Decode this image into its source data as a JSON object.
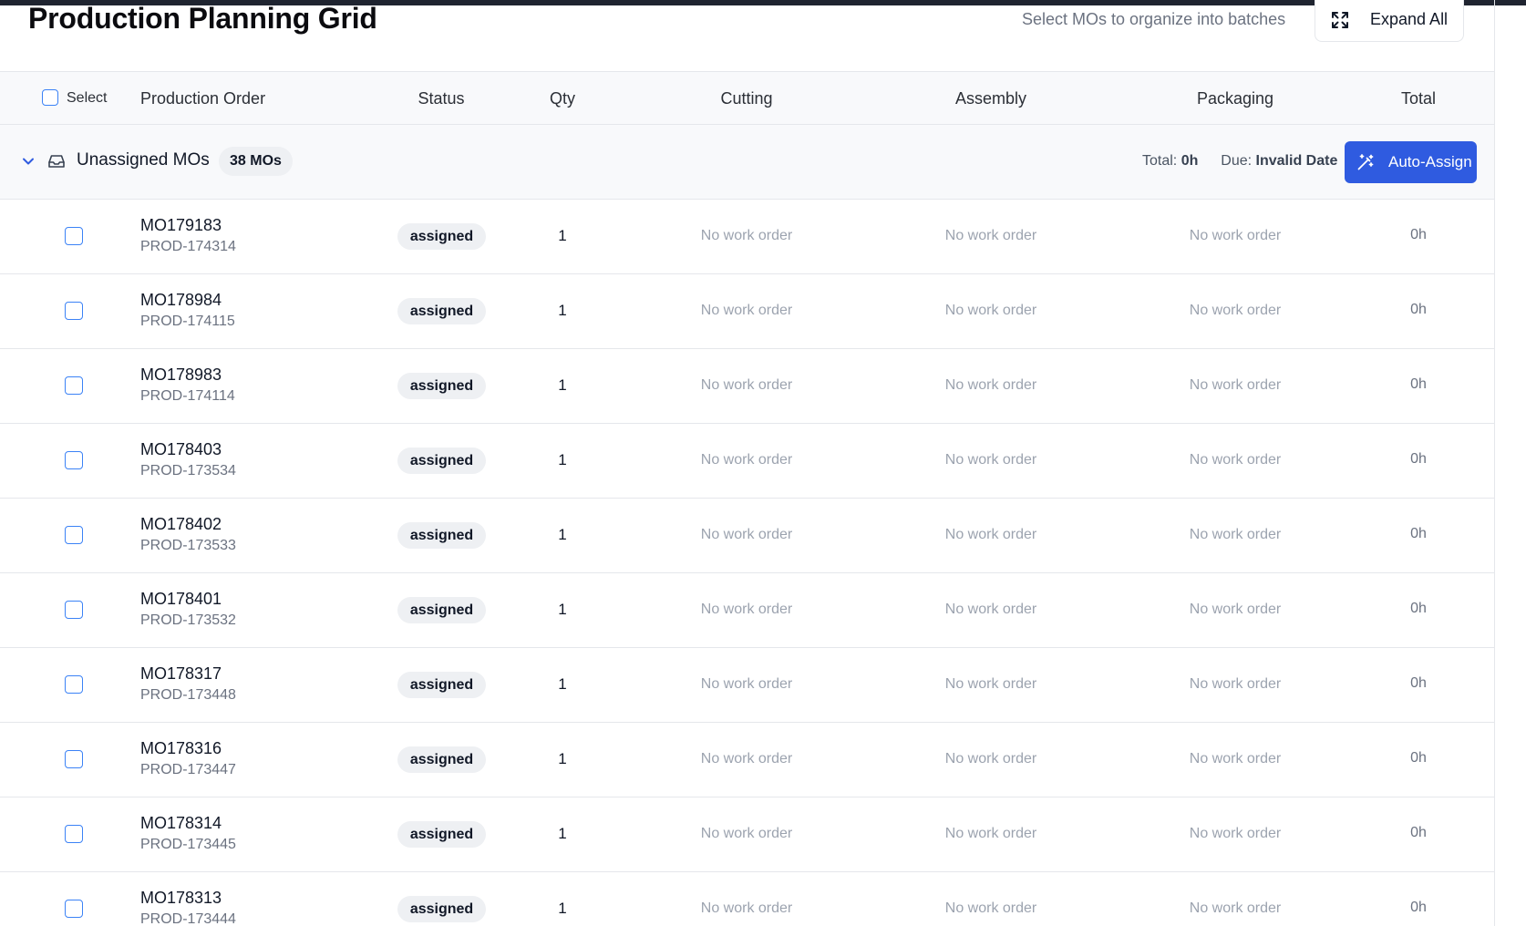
{
  "header": {
    "title": "Production Planning Grid",
    "hint": "Select MOs to organize into batches",
    "expand_all_label": "Expand All"
  },
  "table": {
    "select_label": "Select",
    "columns": {
      "production_order": "Production Order",
      "status": "Status",
      "qty": "Qty",
      "cutting": "Cutting",
      "assembly": "Assembly",
      "packaging": "Packaging",
      "total": "Total"
    }
  },
  "group": {
    "title": "Unassigned MOs",
    "count": "38 MOs",
    "total_label": "Total:",
    "total_value": "0h",
    "due_label": "Due:",
    "due_value": "Invalid Date",
    "auto_assign_label": "Auto-Assign"
  },
  "rows": [
    {
      "mo": "MO179183",
      "prod": "PROD-174314",
      "status": "assigned",
      "qty": "1",
      "cutting": "No work order",
      "assembly": "No work order",
      "packaging": "No work order",
      "total": "0h"
    },
    {
      "mo": "MO178984",
      "prod": "PROD-174115",
      "status": "assigned",
      "qty": "1",
      "cutting": "No work order",
      "assembly": "No work order",
      "packaging": "No work order",
      "total": "0h"
    },
    {
      "mo": "MO178983",
      "prod": "PROD-174114",
      "status": "assigned",
      "qty": "1",
      "cutting": "No work order",
      "assembly": "No work order",
      "packaging": "No work order",
      "total": "0h"
    },
    {
      "mo": "MO178403",
      "prod": "PROD-173534",
      "status": "assigned",
      "qty": "1",
      "cutting": "No work order",
      "assembly": "No work order",
      "packaging": "No work order",
      "total": "0h"
    },
    {
      "mo": "MO178402",
      "prod": "PROD-173533",
      "status": "assigned",
      "qty": "1",
      "cutting": "No work order",
      "assembly": "No work order",
      "packaging": "No work order",
      "total": "0h"
    },
    {
      "mo": "MO178401",
      "prod": "PROD-173532",
      "status": "assigned",
      "qty": "1",
      "cutting": "No work order",
      "assembly": "No work order",
      "packaging": "No work order",
      "total": "0h"
    },
    {
      "mo": "MO178317",
      "prod": "PROD-173448",
      "status": "assigned",
      "qty": "1",
      "cutting": "No work order",
      "assembly": "No work order",
      "packaging": "No work order",
      "total": "0h"
    },
    {
      "mo": "MO178316",
      "prod": "PROD-173447",
      "status": "assigned",
      "qty": "1",
      "cutting": "No work order",
      "assembly": "No work order",
      "packaging": "No work order",
      "total": "0h"
    },
    {
      "mo": "MO178314",
      "prod": "PROD-173445",
      "status": "assigned",
      "qty": "1",
      "cutting": "No work order",
      "assembly": "No work order",
      "packaging": "No work order",
      "total": "0h"
    },
    {
      "mo": "MO178313",
      "prod": "PROD-173444",
      "status": "assigned",
      "qty": "1",
      "cutting": "No work order",
      "assembly": "No work order",
      "packaging": "No work order",
      "total": "0h"
    }
  ],
  "colors": {
    "accent": "#2f5be0",
    "checkbox_border": "#3b82f6",
    "badge_bg": "#eef0f3",
    "muted_text": "#9ca3af"
  },
  "icons": {
    "expand": "expand-icon",
    "chevron": "chevron-down-icon",
    "inbox": "inbox-icon",
    "auto_assign": "magic-wand-icon"
  }
}
